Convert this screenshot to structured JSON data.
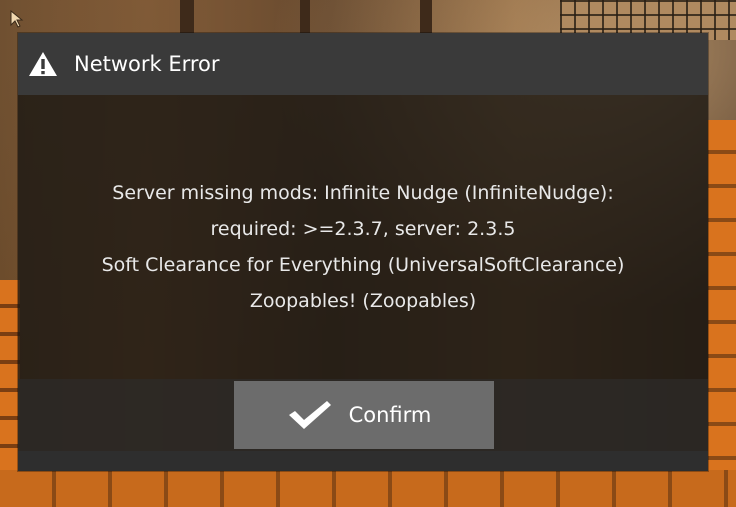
{
  "dialog": {
    "title": "Network Error",
    "title_icon": "warning-icon",
    "message_lines": [
      "Server missing mods: Infinite Nudge (InfiniteNudge):",
      "required: >=2.3.7, server: 2.3.5",
      "Soft Clearance for Everything (UniversalSoftClearance)",
      "Zoopables! (Zoopables)"
    ],
    "confirm_button": {
      "label": "Confirm",
      "icon": "checkmark-icon"
    }
  },
  "colors": {
    "header_bg": "#3a3a3a",
    "button_bg": "#6c6c6c",
    "text": "#ffffff"
  }
}
